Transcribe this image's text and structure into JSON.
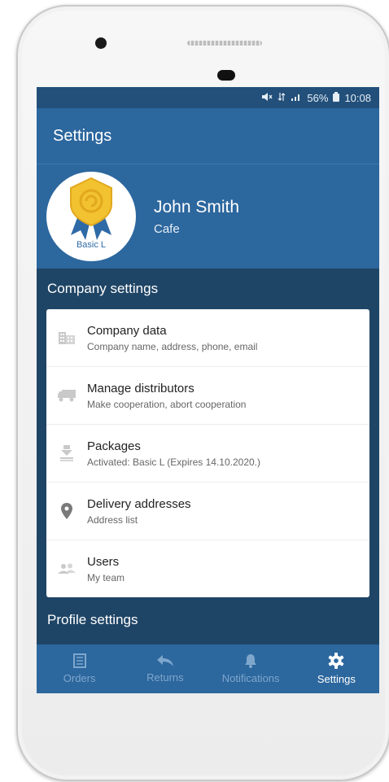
{
  "status_bar": {
    "battery": "56%",
    "time": "10:08"
  },
  "appbar": {
    "title": "Settings"
  },
  "profile": {
    "name": "John Smith",
    "type": "Cafe",
    "badge_label": "Basic L"
  },
  "company_settings": {
    "title": "Company settings",
    "items": [
      {
        "title": "Company data",
        "subtitle": "Company name, address, phone, email",
        "icon": "building-icon"
      },
      {
        "title": "Manage distributors",
        "subtitle": "Make cooperation, abort cooperation",
        "icon": "truck-icon"
      },
      {
        "title": "Packages",
        "subtitle": "Activated: Basic L (Expires 14.10.2020.)",
        "icon": "package-icon"
      },
      {
        "title": "Delivery addresses",
        "subtitle": "Address list",
        "icon": "location-pin-icon"
      },
      {
        "title": "Users",
        "subtitle": "My team",
        "icon": "team-icon"
      }
    ]
  },
  "profile_settings": {
    "title": "Profile settings"
  },
  "bottom_nav": [
    {
      "label": "Orders",
      "icon": "orders-icon"
    },
    {
      "label": "Returns",
      "icon": "return-arrow-icon"
    },
    {
      "label": "Notifications",
      "icon": "bell-icon"
    },
    {
      "label": "Settings",
      "icon": "gear-icon",
      "active": true
    }
  ],
  "colors": {
    "primary": "#2c679e",
    "dark": "#1f4566",
    "badge_gold": "#f2c230",
    "badge_blue": "#2e6aa6"
  }
}
